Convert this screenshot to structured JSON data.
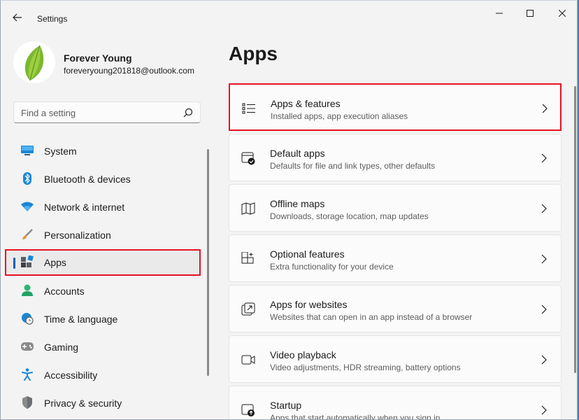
{
  "window": {
    "title": "Settings"
  },
  "profile": {
    "name": "Forever Young",
    "email": "foreveryoung201818@outlook.com"
  },
  "search": {
    "placeholder": "Find a setting"
  },
  "nav": {
    "items": [
      {
        "label": "System",
        "icon": "monitor-icon"
      },
      {
        "label": "Bluetooth & devices",
        "icon": "bluetooth-icon"
      },
      {
        "label": "Network & internet",
        "icon": "wifi-icon"
      },
      {
        "label": "Personalization",
        "icon": "brush-icon"
      },
      {
        "label": "Apps",
        "icon": "apps-icon",
        "selected": true
      },
      {
        "label": "Accounts",
        "icon": "person-icon"
      },
      {
        "label": "Time & language",
        "icon": "globe-clock-icon"
      },
      {
        "label": "Gaming",
        "icon": "gamepad-icon"
      },
      {
        "label": "Accessibility",
        "icon": "accessibility-icon"
      },
      {
        "label": "Privacy & security",
        "icon": "shield-icon"
      }
    ]
  },
  "main": {
    "title": "Apps",
    "cards": [
      {
        "title": "Apps & features",
        "desc": "Installed apps, app execution aliases",
        "icon": "list-icon",
        "highlighted": true
      },
      {
        "title": "Default apps",
        "desc": "Defaults for file and link types, other defaults",
        "icon": "default-apps-icon"
      },
      {
        "title": "Offline maps",
        "desc": "Downloads, storage location, map updates",
        "icon": "map-icon"
      },
      {
        "title": "Optional features",
        "desc": "Extra functionality for your device",
        "icon": "add-grid-icon"
      },
      {
        "title": "Apps for websites",
        "desc": "Websites that can open in an app instead of a browser",
        "icon": "open-link-icon"
      },
      {
        "title": "Video playback",
        "desc": "Video adjustments, HDR streaming, battery options",
        "icon": "video-icon"
      },
      {
        "title": "Startup",
        "desc": "Apps that start automatically when you sign in",
        "icon": "startup-icon"
      }
    ]
  },
  "colors": {
    "accent": "#005fb8",
    "highlight": "#e81123",
    "background": "#f3f3f3"
  }
}
